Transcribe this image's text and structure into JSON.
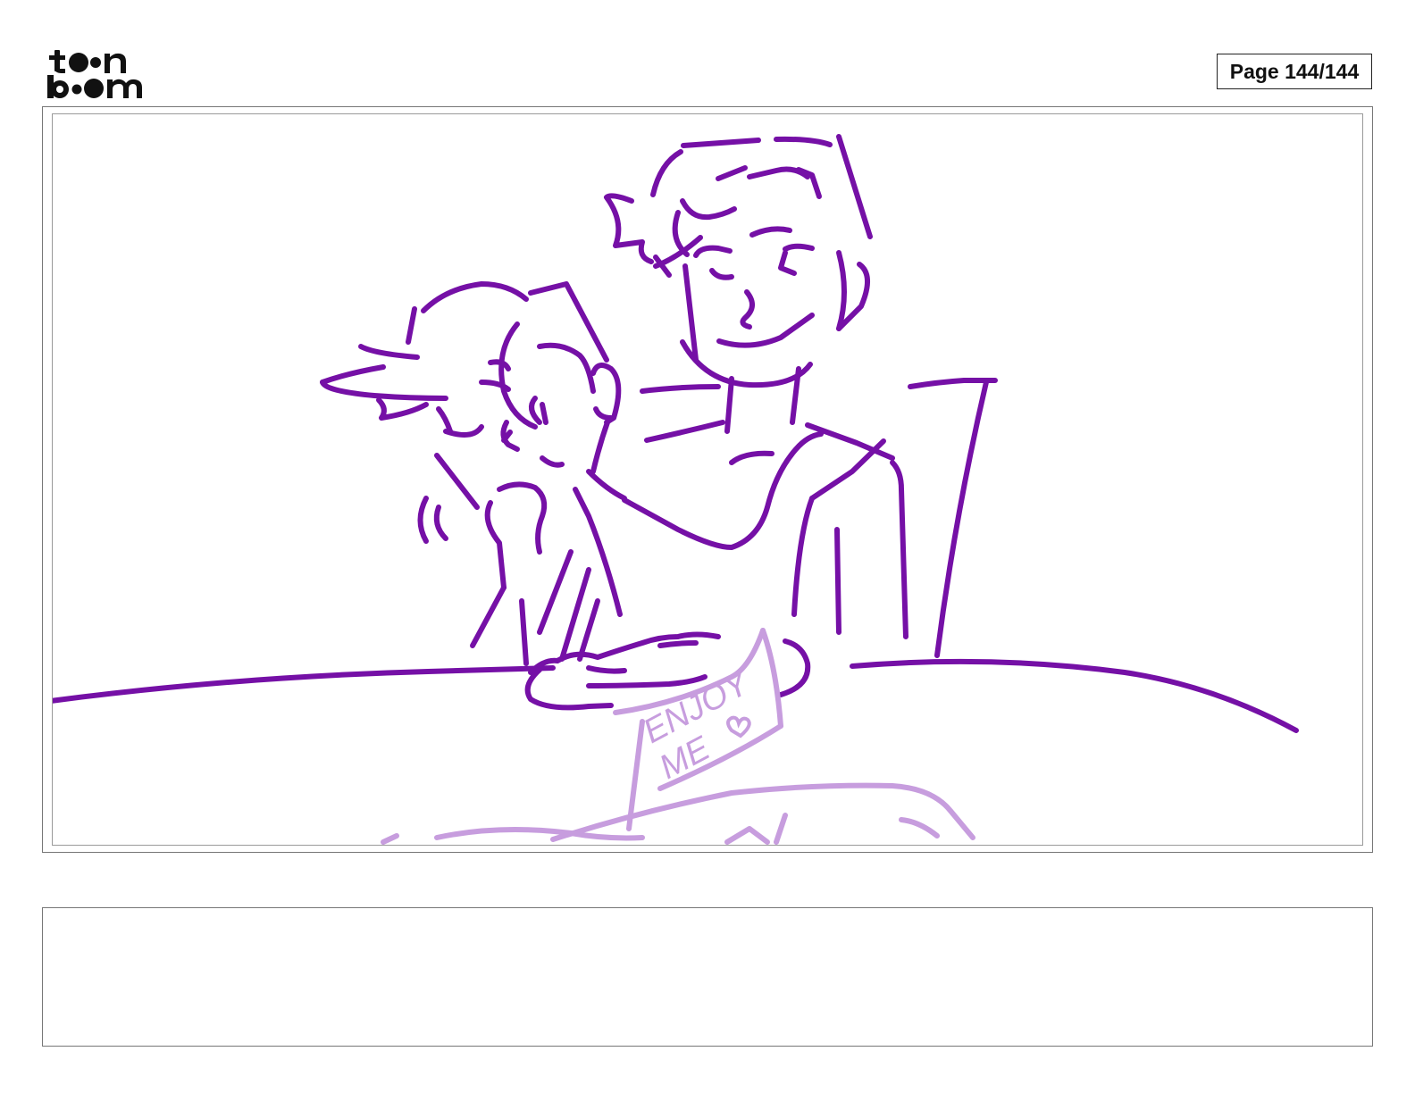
{
  "header": {
    "logo_icon": "toon-boom-logo-icon",
    "logo_text_line1": "toon",
    "logo_text_line2": "boom",
    "page_label": "Page 144/144"
  },
  "panel": {
    "sketch_color": "#7510A6",
    "faded_sketch_color": "#C79DDE",
    "sign_text_line1": "ENJOY",
    "sign_text_line2": "ME"
  },
  "notes": {
    "text": ""
  }
}
